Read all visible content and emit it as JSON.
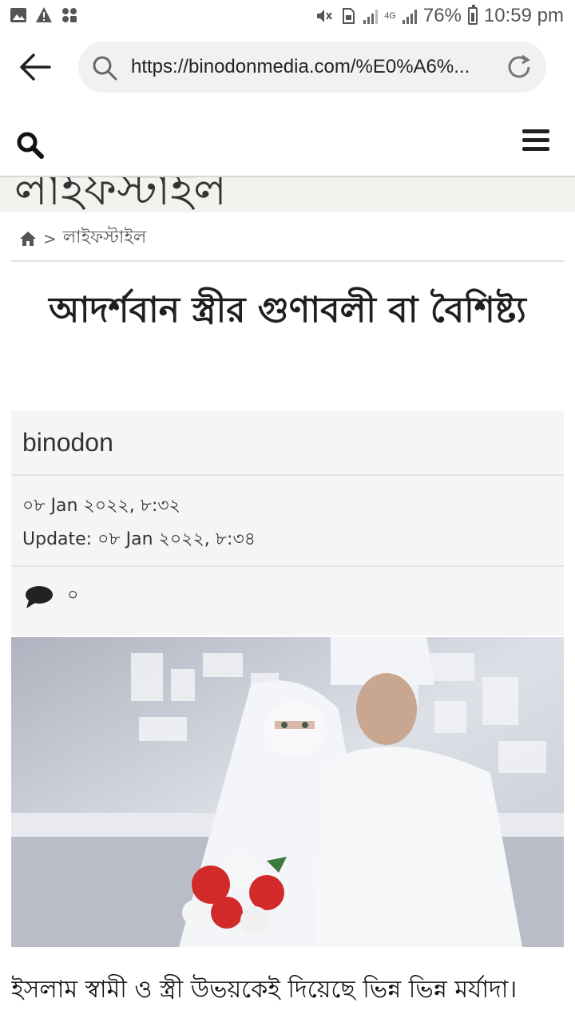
{
  "status_bar": {
    "battery": "76%",
    "time": "10:59 pm",
    "network": "4G",
    "icons": [
      "image-icon",
      "warning-icon",
      "apps-icon",
      "mute-icon",
      "sim-icon",
      "signal-icon",
      "battery-icon"
    ]
  },
  "browser": {
    "url": "https://binodonmedia.com/%E0%A6%...",
    "icons": [
      "back-arrow-icon",
      "search-icon",
      "reload-icon"
    ]
  },
  "site_header": {
    "icons": [
      "search-icon",
      "menu-icon"
    ]
  },
  "category_banner": {
    "text": "লাইফস্টাইল"
  },
  "breadcrumb": {
    "current": "লাইফস্টাইল",
    "separator": ">"
  },
  "article": {
    "title": "আদর্শবান স্ত্রীর গুণাবলী বা বৈশিষ্ট্য",
    "author": "binodon",
    "published": "০৮ Jan ২০২২, ৮:৩২",
    "updated": "Update: ০৮ Jan ২০২২, ৮:৩৪",
    "comment_count": "০",
    "body_first_line": "ইসলাম স্বামী ও স্ত্রী উভয়কেই দিয়েছে ভিন্ন ভিন্ন মর্যাদা।"
  },
  "colors": {
    "accent": "#222222",
    "meta_background": "#f5f5f5",
    "url_pill": "#f1f1f1"
  }
}
